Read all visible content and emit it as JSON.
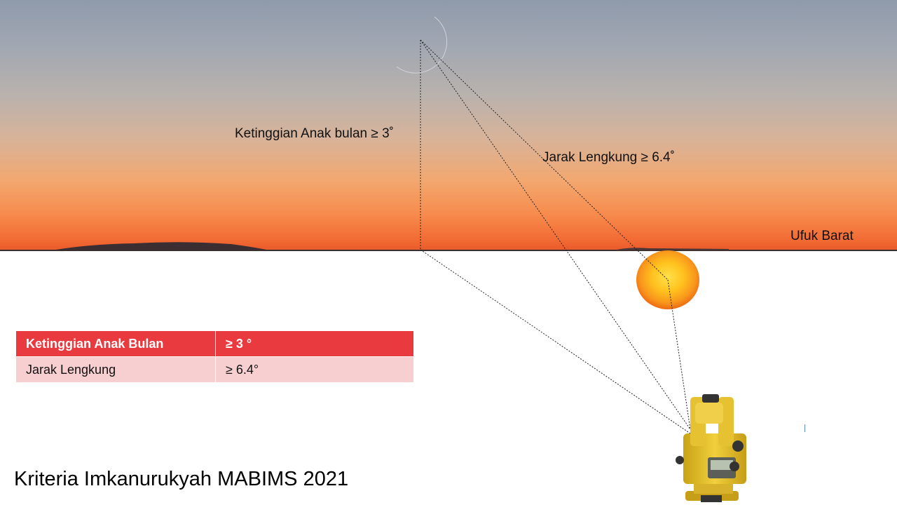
{
  "labels": {
    "moon_height": "Ketinggian Anak bulan ≥ 3˚",
    "arc_distance": "Jarak Lengkung  ≥ 6.4˚",
    "horizon": "Ufuk  Barat"
  },
  "table": {
    "header": [
      "Ketinggian  Anak Bulan",
      "≥ 3 °"
    ],
    "rows": [
      [
        "Jarak  Lengkung",
        "≥ 6.4°"
      ]
    ]
  },
  "title": "Kriteria Imkanurukyah MABIMS 2021",
  "colors": {
    "table_header": "#e93a3f",
    "table_row": "#f7cfd0",
    "sun_core": "#ffd21e",
    "sun_edge": "#f06a12",
    "theodolite": "#e6c232"
  },
  "icons": {
    "moon": "crescent-moon-icon",
    "sun": "sun-icon",
    "instrument": "theodolite-icon"
  }
}
